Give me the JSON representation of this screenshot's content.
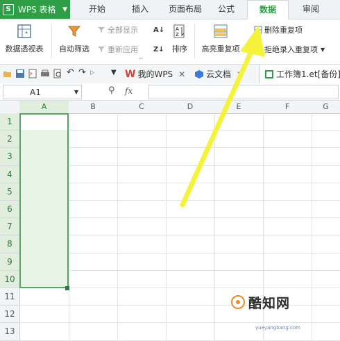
{
  "app": {
    "title": "WPS 表格",
    "logo": "S"
  },
  "menu_tabs": [
    {
      "label": "开始",
      "active": false
    },
    {
      "label": "插入",
      "active": false
    },
    {
      "label": "页面布局",
      "active": false
    },
    {
      "label": "公式",
      "active": false
    },
    {
      "label": "数据",
      "active": true
    },
    {
      "label": "审阅",
      "active": false
    }
  ],
  "ribbon": {
    "pivot": "数据透视表",
    "autofilter": "自动筛选",
    "show_all": "全部显示",
    "reapply": "重新应用",
    "sort": "排序",
    "highlight_dup": "高亮重复项",
    "remove_dup": "删除重复项",
    "reject_dup": "拒绝录入重复项"
  },
  "doc_tabs": [
    {
      "label": "我的WPS",
      "icon": "wps-w-icon"
    },
    {
      "label": "云文档",
      "icon": "cloud-cube-icon"
    },
    {
      "label": "工作簿1.et[备份]",
      "icon": "sheet-icon"
    }
  ],
  "formula_bar": {
    "cell_ref": "A1",
    "fx": "fx"
  },
  "columns": [
    "A",
    "B",
    "C",
    "D",
    "E",
    "F",
    "G"
  ],
  "rows": [
    "1",
    "2",
    "3",
    "4",
    "5",
    "6",
    "7",
    "8",
    "9",
    "10",
    "11",
    "12",
    "13"
  ],
  "selection": {
    "range": "A1:A10",
    "active_cell": "A1"
  },
  "annotation": {
    "arrow_color": "#f5f23a",
    "points_to": "数据"
  },
  "watermark": {
    "text": "酷知网",
    "domain": "yueyangbang.com"
  },
  "colors": {
    "accent": "#2e9e47",
    "selection_fill": "#e8f4e3",
    "selection_border": "#5aa468"
  }
}
